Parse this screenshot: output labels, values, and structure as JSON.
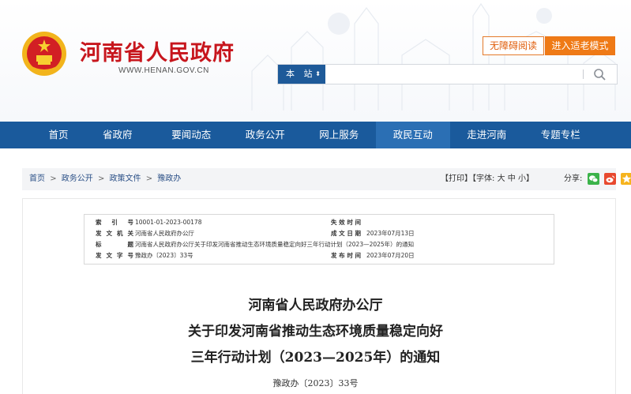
{
  "header": {
    "site_name": "河南省人民政府",
    "site_domain": "WWW.HENAN.GOV.CN",
    "accessibility_label": "无障碍阅读",
    "elder_mode_label": "进入适老模式",
    "search": {
      "scope_label": "本 站",
      "placeholder": ""
    }
  },
  "nav": {
    "items": [
      {
        "label": "首页"
      },
      {
        "label": "省政府"
      },
      {
        "label": "要闻动态"
      },
      {
        "label": "政务公开"
      },
      {
        "label": "网上服务"
      },
      {
        "label": "政民互动"
      },
      {
        "label": "走进河南"
      },
      {
        "label": "专题专栏"
      }
    ],
    "active_index": 5
  },
  "breadcrumb": {
    "items": [
      "首页",
      "政务公开",
      "政策文件",
      "豫政办"
    ],
    "separator": ">"
  },
  "tools": {
    "print": "【打印】",
    "font_prefix": "【字体:",
    "font_large": "大",
    "font_medium": "中",
    "font_small": "小",
    "font_suffix": "】",
    "share_label": "分享:"
  },
  "meta": {
    "index_label": "索 引 号",
    "index_value": "10001-01-2023-00178",
    "expiry_label": "失效时间",
    "expiry_value": "",
    "issuer_label": "发文机关",
    "issuer_value": "河南省人民政府办公厅",
    "issue_date_label": "成文日期",
    "issue_date_value": "2023年07月13日",
    "title_label": "标　　题",
    "title_value": "河南省人民政府办公厅关于印发河南省推动生态环境质量稳定向好三年行动计划（2023—2025年）的通知",
    "doc_no_label": "发文字号",
    "doc_no_value": "豫政办〔2023〕33号",
    "publish_date_label": "发布时间",
    "publish_date_value": "2023年07月20日"
  },
  "document": {
    "title_line1": "河南省人民政府办公厅",
    "title_line2": "关于印发河南省推动生态环境质量稳定向好",
    "title_line3": "三年行动计划（2023—2025年）的通知",
    "doc_number": "豫政办〔2023〕33号"
  },
  "colors": {
    "brand_red": "#c7161d",
    "nav_blue": "#1a5a9c",
    "nav_active": "#2b6fb4",
    "accent_orange": "#ef7a16"
  }
}
